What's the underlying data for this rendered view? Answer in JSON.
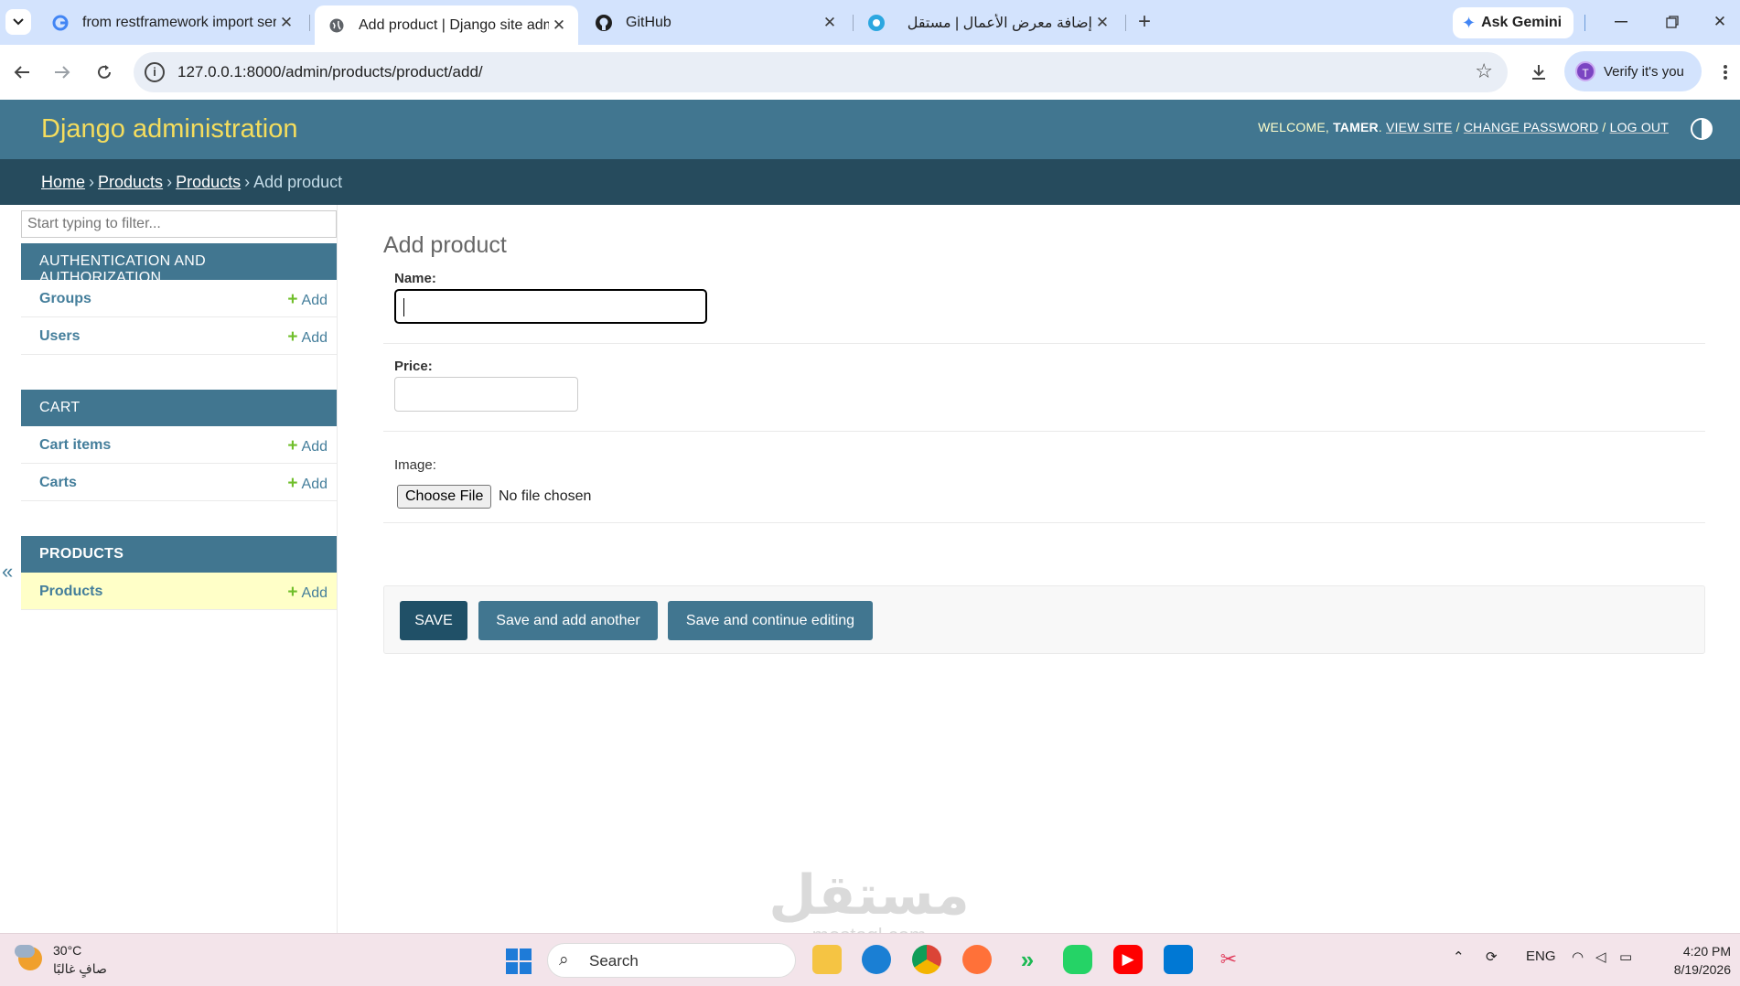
{
  "browser": {
    "tabs": [
      {
        "title": "from restframework import seri",
        "favicon": "google-icon"
      },
      {
        "title": "Add product | Django site admi",
        "favicon": "globe-icon",
        "active": true
      },
      {
        "title": "GitHub",
        "favicon": "github-icon"
      },
      {
        "title": "إضافة معرض الأعمال | مستقل",
        "favicon": "mostaql-icon"
      }
    ],
    "ask_gemini": "Ask Gemini",
    "url": "127.0.0.1:8000/admin/products/product/add/",
    "verify_label": "Verify it's you",
    "profile_initial": "T"
  },
  "admin": {
    "site_title": "Django administration",
    "welcome": "WELCOME,",
    "username": "TAMER",
    "view_site": "VIEW SITE",
    "change_password": "CHANGE PASSWORD",
    "log_out": "LOG OUT",
    "separator": "/"
  },
  "breadcrumbs": {
    "home": "Home",
    "app": "Products",
    "model": "Products",
    "current": "Add product"
  },
  "sidebar": {
    "filter_placeholder": "Start typing to filter...",
    "add_label": "Add",
    "modules": [
      {
        "caption": "AUTHENTICATION AND AUTHORIZATION",
        "models": [
          "Groups",
          "Users"
        ]
      },
      {
        "caption": "CART",
        "models": [
          "Cart items",
          "Carts"
        ]
      },
      {
        "caption": "PRODUCTS",
        "models": [
          "Products"
        ]
      }
    ],
    "collapse": "«"
  },
  "form": {
    "title": "Add product",
    "name_label": "Name:",
    "name_value": "",
    "price_label": "Price:",
    "price_value": "",
    "image_label": "Image:",
    "choose_file": "Choose File",
    "no_file": "No file chosen",
    "save": "SAVE",
    "save_add_another": "Save and add another",
    "save_continue": "Save and continue editing"
  },
  "watermark": {
    "text": "مستقل",
    "sub": "mostaql.com"
  },
  "taskbar": {
    "temperature": "30°C",
    "weather": "صافٍ غالبًا",
    "search": "Search",
    "language": "ENG",
    "time": "4:20 PM",
    "date": "8/19/2026"
  },
  "colors": {
    "header": "#417690",
    "breadcrumbs": "#264b5d",
    "branding": "#f5dd5d",
    "selected_row": "#ffffc8",
    "add_plus": "#70bf2b",
    "save_default": "#205067"
  }
}
